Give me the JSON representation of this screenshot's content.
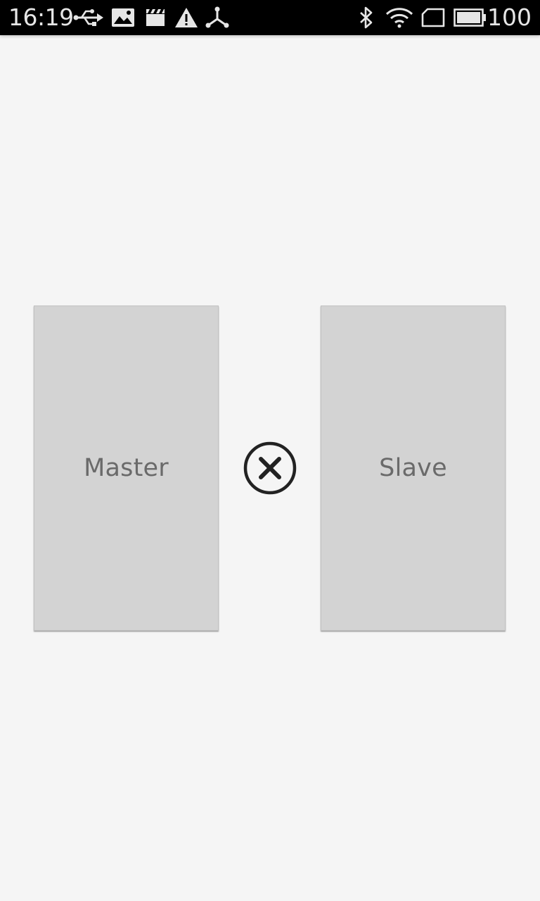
{
  "status_bar": {
    "time": "16:19",
    "battery_level": "100",
    "icons": [
      "usb-icon",
      "image-icon",
      "clapperboard-icon",
      "warning-icon",
      "share-icon",
      "bluetooth-icon",
      "wifi-icon",
      "cellular-icon",
      "battery-icon"
    ]
  },
  "cards": {
    "master_label": "Master",
    "slave_label": "Slave"
  },
  "center": {
    "icon": "close-circle-icon"
  },
  "colors": {
    "background": "#f5f5f5",
    "card": "#d3d3d3",
    "label": "#6a6a6a",
    "icon": "#222222"
  }
}
